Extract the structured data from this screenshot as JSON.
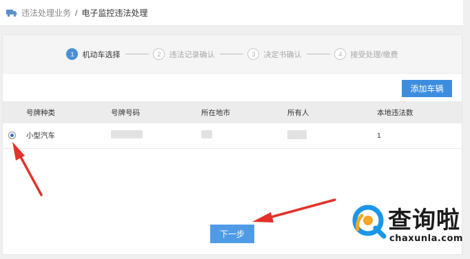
{
  "breadcrumb": {
    "parent": "违法处理业务",
    "separator": "/",
    "current": "电子监控违法处理"
  },
  "steps": [
    {
      "number": "1",
      "label": "机动车选择",
      "active": true
    },
    {
      "number": "2",
      "label": "违法记录确认",
      "active": false
    },
    {
      "number": "3",
      "label": "决定书确认",
      "active": false
    },
    {
      "number": "4",
      "label": "接受处理/缴费",
      "active": false
    }
  ],
  "toolbar": {
    "add_vehicle_label": "添加车辆"
  },
  "table": {
    "headers": [
      "号牌种类",
      "号牌号码",
      "所在地市",
      "所有人",
      "本地违法数"
    ],
    "rows": [
      {
        "selected": true,
        "plate_type": "小型汽车",
        "violations": "1"
      }
    ]
  },
  "actions": {
    "next_label": "下一步"
  },
  "watermark": {
    "name": "查询啦",
    "domain": "chaxunla.com"
  },
  "colors": {
    "accent": "#3c8de0",
    "annotation_arrow": "#e2322b",
    "watermark_logo": "#1a97e8"
  }
}
